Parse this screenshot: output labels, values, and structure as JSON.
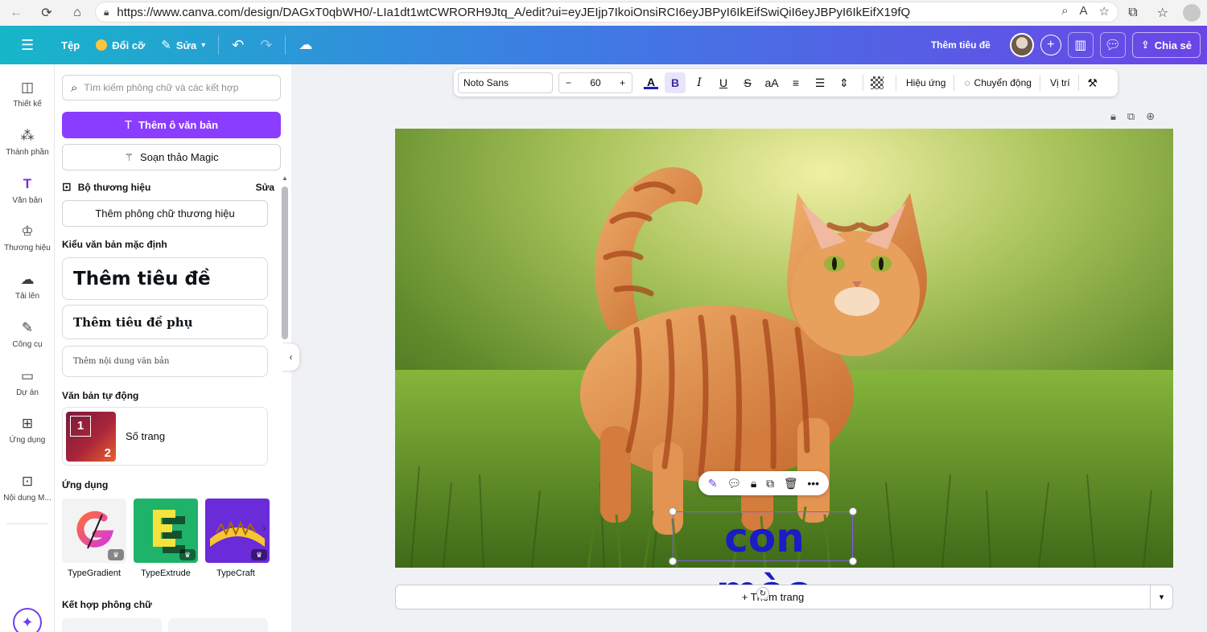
{
  "browser": {
    "url": "https://www.canva.com/design/DAGxT0qbWH0/-LIa1dt1wtCWRORH9Jtq_A/edit?ui=eyJEIjp7IkoiOnsiRCI6eyJBPyI6IkEifSwiQiI6eyJBPyI6IkEifX19fQ"
  },
  "topbar": {
    "file": "Tệp",
    "resize": "Đổi cỡ",
    "edit": "Sửa",
    "title": "Thêm tiêu đề",
    "share": "Chia sẻ",
    "colors": {
      "gradient_start": "#17b6c9",
      "gradient_end": "#6b45e6"
    }
  },
  "rail": {
    "items": [
      {
        "label": "Thiết kế",
        "icon": "layout-icon"
      },
      {
        "label": "Thành phần",
        "icon": "elements-icon"
      },
      {
        "label": "Văn bản",
        "icon": "text-icon",
        "active": true
      },
      {
        "label": "Thương hiệu",
        "icon": "brand-icon"
      },
      {
        "label": "Tải lên",
        "icon": "upload-icon"
      },
      {
        "label": "Công cụ",
        "icon": "draw-icon"
      },
      {
        "label": "Dự án",
        "icon": "folder-icon"
      },
      {
        "label": "Ứng dụng",
        "icon": "apps-icon"
      },
      {
        "label": "Nội dung M...",
        "icon": "magic-media-icon"
      }
    ]
  },
  "panel": {
    "search_placeholder": "Tìm kiếm phông chữ và các kết hợp",
    "add_textbox": "Thêm ô văn bản",
    "magic_write": "Soạn thảo Magic",
    "brand_kit": "Bộ thương hiệu",
    "brand_edit": "Sửa",
    "add_brand_fonts": "Thêm phông chữ thương hiệu",
    "default_styles": "Kiểu văn bản mặc định",
    "style_heading": "Thêm tiêu đề",
    "style_subheading": "Thêm tiêu đề phụ",
    "style_body": "Thêm nội dung văn bản",
    "dynamic_text": "Văn bản tự động",
    "page_numbers": "Số trang",
    "page_thumb_1": "1",
    "page_thumb_2": "2",
    "apps_title": "Ứng dụng",
    "apps": [
      {
        "name": "TypeGradient"
      },
      {
        "name": "TypeExtrude"
      },
      {
        "name": "TypeCraft"
      }
    ],
    "font_combos": "Kết hợp phông chữ",
    "brand_accent": "#8b3dff"
  },
  "text_toolbar": {
    "font": "Noto Sans",
    "size": "60",
    "decrease": "−",
    "increase": "+",
    "effects": "Hiệu ứng",
    "animate": "Chuyển động",
    "position": "Vị trí"
  },
  "canvas": {
    "caption": "con mèo",
    "caption_color": "#1c1cc4"
  },
  "footer": {
    "add_page": "+ Thêm trang"
  }
}
